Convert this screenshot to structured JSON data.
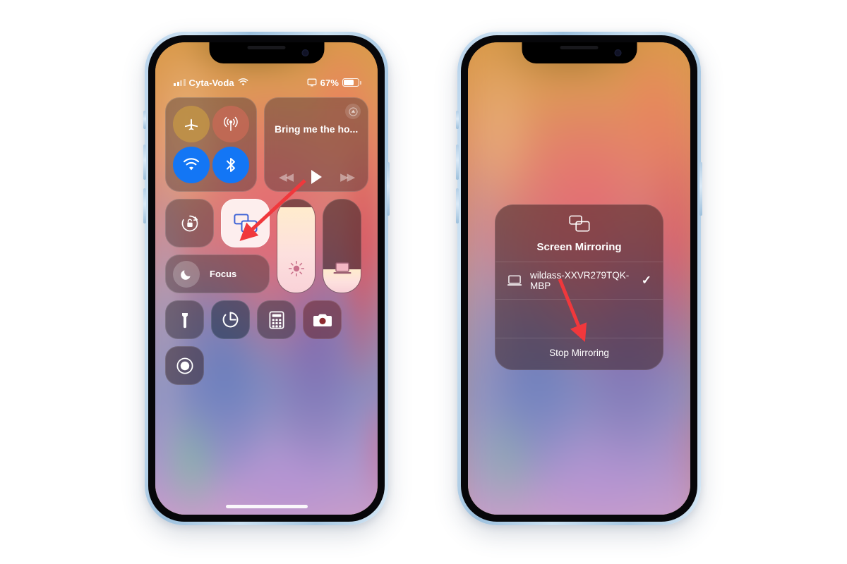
{
  "accent_colors": {
    "arrow_red": "#f0383c",
    "active_tile_bg": "#fff6f3",
    "mirroring_icon_blue": "#3f63d6",
    "wifi_blue": "#1376f5",
    "bluetooth_blue": "#1376f5"
  },
  "phones": [
    {
      "id": "phone-left",
      "status_bar": {
        "carrier": "Cyta-Voda",
        "signal_icon": "cellular-bars-icon",
        "wifi_icon": "wifi-icon",
        "mirroring_indicator_icon": "screen-mirroring-indicator-icon",
        "battery_percent": "67%",
        "battery_icon": "battery-icon"
      },
      "control_center": {
        "connectivity": {
          "airplane": {
            "label": "Airplane Mode",
            "icon": "airplane-icon",
            "state": "off"
          },
          "cellular": {
            "label": "Cellular Data",
            "icon": "cellular-antenna-icon",
            "state": "on"
          },
          "wifi": {
            "label": "Wi-Fi",
            "icon": "wifi-icon",
            "state": "on"
          },
          "bluetooth": {
            "label": "Bluetooth",
            "icon": "bluetooth-icon",
            "state": "on"
          }
        },
        "media": {
          "track_title": "Bring me the ho...",
          "airplay_icon": "airplay-audio-icon",
          "rewind_icon": "rewind-icon",
          "play_icon": "play-icon",
          "forward_icon": "fast-forward-icon"
        },
        "rotation_lock": {
          "label": "Rotation Lock",
          "icon": "rotation-lock-icon",
          "state": "off"
        },
        "screen_mirroring": {
          "label": "Screen Mirroring",
          "icon": "screen-mirroring-icon",
          "state": "active"
        },
        "focus": {
          "label": "Focus",
          "icon": "moon-icon",
          "state": "off"
        },
        "brightness": {
          "label": "Brightness",
          "icon": "brightness-sun-icon",
          "level_percent": 92
        },
        "volume": {
          "label": "Volume",
          "icon": "laptop-output-icon",
          "level_percent": 25
        },
        "shortcuts": [
          {
            "label": "Flashlight",
            "icon": "flashlight-icon"
          },
          {
            "label": "Timer",
            "icon": "timer-icon"
          },
          {
            "label": "Calculator",
            "icon": "calculator-icon"
          },
          {
            "label": "Camera",
            "icon": "camera-icon"
          },
          {
            "label": "Screen Recording",
            "icon": "screen-record-icon"
          }
        ]
      }
    },
    {
      "id": "phone-right",
      "mirroring_panel": {
        "header_icon": "screen-mirroring-icon",
        "title": "Screen Mirroring",
        "devices": [
          {
            "name": "wildass-XXVR279TQK-MBP",
            "icon": "laptop-icon",
            "selected": true,
            "check_icon": "checkmark-icon"
          }
        ],
        "stop_label": "Stop Mirroring"
      }
    }
  ],
  "annotations": [
    {
      "id": "arrow-to-screen-mirroring-tile",
      "points_to": "screen-mirroring-tile",
      "color": "#f0383c"
    },
    {
      "id": "arrow-to-stop-mirroring",
      "points_to": "stop-mirroring-button",
      "color": "#f0383c"
    }
  ]
}
